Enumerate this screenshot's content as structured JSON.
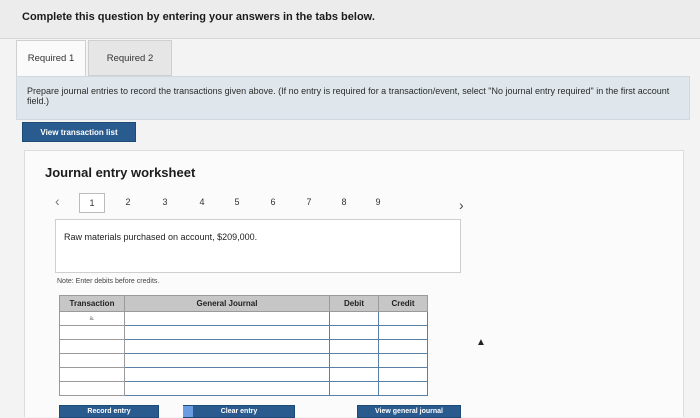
{
  "header": {
    "instruction": "Complete this question by entering your answers in the tabs below."
  },
  "tabs": [
    {
      "label": "Required 1"
    },
    {
      "label": "Required 2"
    }
  ],
  "instructions": {
    "text": "Prepare journal entries to record the transactions given above. (If no entry is required for a transaction/event, select \"No journal entry required\" in the first account field.)"
  },
  "buttons": {
    "view_transaction_list": "View transaction list",
    "record_entry": "Record entry",
    "clear_entry": "Clear entry",
    "view_general_journal": "View general journal"
  },
  "worksheet": {
    "title": "Journal entry worksheet",
    "nav": {
      "prev_icon": "chevron-left-icon",
      "next_icon": "chevron-right-icon",
      "pages": [
        "1",
        "2",
        "3",
        "4",
        "5",
        "6",
        "7",
        "8",
        "9"
      ],
      "active_page": "1"
    },
    "description": "Raw materials purchased on account, $209,000.",
    "note": "Note: Enter debits before credits.",
    "table": {
      "headers": {
        "transaction": "Transaction",
        "general_journal": "General Journal",
        "debit": "Debit",
        "credit": "Credit"
      },
      "rows": [
        {
          "transaction": "a."
        },
        {
          "transaction": ""
        },
        {
          "transaction": ""
        },
        {
          "transaction": ""
        },
        {
          "transaction": ""
        },
        {
          "transaction": ""
        }
      ]
    }
  },
  "colors": {
    "button_blue": "#2a5b8f",
    "instruction_bg": "#dfe7ec",
    "table_header": "#c6c6c6"
  }
}
